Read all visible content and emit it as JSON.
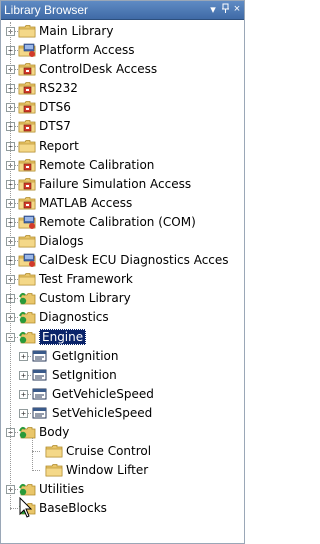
{
  "panel": {
    "title": "Library Browser",
    "dropdown_glyph": "▾",
    "pin_glyph": "ᵖ",
    "close_glyph": "×"
  },
  "tree": [
    {
      "label": "Main Library",
      "icon": "folder-icon",
      "depth": 0,
      "expander": "+"
    },
    {
      "label": "Platform Access",
      "icon": "platform-folder-icon",
      "depth": 0,
      "expander": "+"
    },
    {
      "label": "ControlDesk Access",
      "icon": "red-folder-icon",
      "depth": 0,
      "expander": "+"
    },
    {
      "label": "RS232",
      "icon": "red-folder-icon",
      "depth": 0,
      "expander": "+"
    },
    {
      "label": "DTS6",
      "icon": "red-folder-icon",
      "depth": 0,
      "expander": "+"
    },
    {
      "label": "DTS7",
      "icon": "red-folder-icon",
      "depth": 0,
      "expander": "+"
    },
    {
      "label": "Report",
      "icon": "folder-icon",
      "depth": 0,
      "expander": "+"
    },
    {
      "label": "Remote Calibration",
      "icon": "red-folder-icon",
      "depth": 0,
      "expander": "+"
    },
    {
      "label": "Failure Simulation Access",
      "icon": "red-folder-icon",
      "depth": 0,
      "expander": "+"
    },
    {
      "label": "MATLAB Access",
      "icon": "red-folder-icon",
      "depth": 0,
      "expander": "+"
    },
    {
      "label": "Remote Calibration (COM)",
      "icon": "platform-folder-icon",
      "depth": 0,
      "expander": "+"
    },
    {
      "label": "Dialogs",
      "icon": "folder-icon",
      "depth": 0,
      "expander": "+"
    },
    {
      "label": "CalDesk ECU Diagnostics Acces",
      "icon": "platform-folder-icon",
      "depth": 0,
      "expander": "+"
    },
    {
      "label": "Test Framework",
      "icon": "folder-icon",
      "depth": 0,
      "expander": "+"
    },
    {
      "label": "Custom Library",
      "icon": "custom-library-icon",
      "depth": 0,
      "expander": "+"
    },
    {
      "label": "Diagnostics",
      "icon": "custom-library-icon",
      "depth": 0,
      "expander": "+"
    },
    {
      "label": "Engine",
      "icon": "custom-library-icon",
      "depth": 0,
      "expander": "−",
      "selected": true
    },
    {
      "label": "GetIgnition",
      "icon": "block-icon",
      "depth": 1,
      "expander": "+"
    },
    {
      "label": "SetIgnition",
      "icon": "block-icon",
      "depth": 1,
      "expander": "+"
    },
    {
      "label": "GetVehicleSpeed",
      "icon": "block-icon",
      "depth": 1,
      "expander": "+"
    },
    {
      "label": "SetVehicleSpeed",
      "icon": "block-icon",
      "depth": 1,
      "expander": "+"
    },
    {
      "label": "Body",
      "icon": "custom-library-icon",
      "depth": 0,
      "expander": "−"
    },
    {
      "label": "Cruise Control",
      "icon": "folder-icon",
      "depth": 2,
      "expander": ""
    },
    {
      "label": "Window Lifter",
      "icon": "folder-icon",
      "depth": 2,
      "expander": ""
    },
    {
      "label": "Utilities",
      "icon": "custom-library-icon",
      "depth": 0,
      "expander": "+"
    },
    {
      "label": "BaseBlocks",
      "icon": "custom-library-icon",
      "depth": 0,
      "expander": ""
    }
  ],
  "colors": {
    "folder": "#e9c66a",
    "selection": "#0a246a",
    "titlebar": "#4a76b3"
  }
}
